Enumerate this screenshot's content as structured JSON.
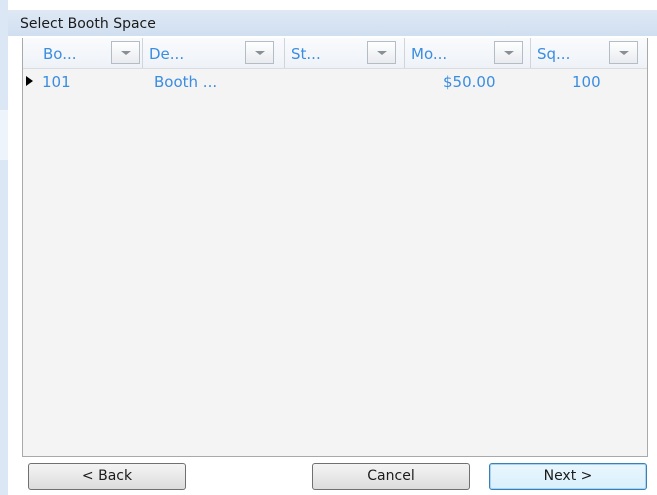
{
  "dialog": {
    "title": "Select Booth Space"
  },
  "grid": {
    "columns": [
      {
        "label": "Bo..."
      },
      {
        "label": "De..."
      },
      {
        "label": "St..."
      },
      {
        "label": "Mo..."
      },
      {
        "label": "Sq..."
      }
    ],
    "rows": [
      {
        "cells": [
          "101",
          "Booth ...",
          "",
          "$50.00",
          "100"
        ]
      }
    ]
  },
  "buttons": {
    "back_label": "< Back",
    "cancel_label": "Cancel",
    "next_label": "Next >"
  },
  "icons": {
    "filter": "chevron-down-icon",
    "current_row": "row-pointer-icon"
  },
  "colors": {
    "grid_text": "#3a8de0",
    "title_bar": "#d6e3f2",
    "grid_background": "#f4f4f4"
  }
}
